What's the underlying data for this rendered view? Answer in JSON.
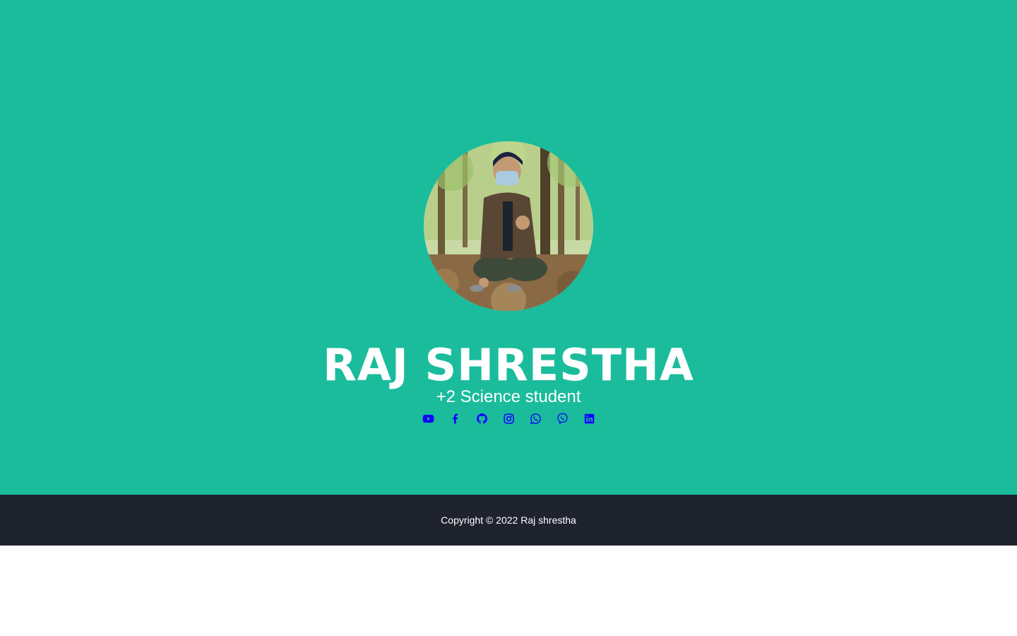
{
  "profile": {
    "name": "RAJ SHRESTHA",
    "subtitle": "+2 Science student"
  },
  "social_links": [
    {
      "icon": "youtube-icon"
    },
    {
      "icon": "facebook-icon"
    },
    {
      "icon": "github-icon"
    },
    {
      "icon": "instagram-icon"
    },
    {
      "icon": "whatsapp-icon"
    },
    {
      "icon": "viber-icon"
    },
    {
      "icon": "linkedin-icon"
    }
  ],
  "footer": {
    "copyright": "Copyright © 2022 Raj shrestha"
  },
  "colors": {
    "hero_background": "#1abc9c",
    "footer_background": "#1e232e",
    "icon_color": "#1400ff",
    "text": "#ffffff"
  }
}
